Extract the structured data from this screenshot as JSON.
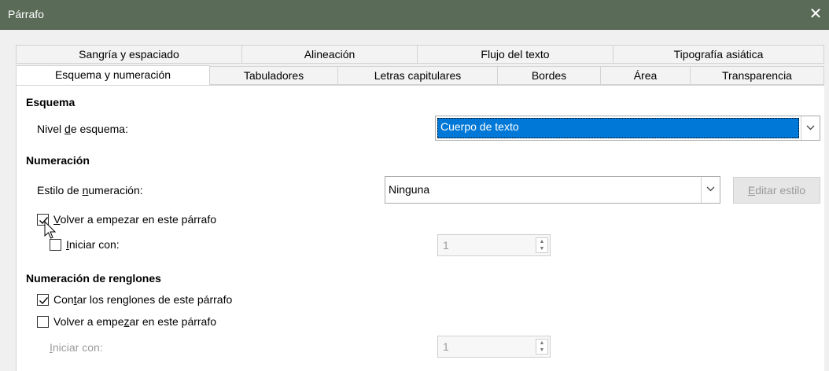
{
  "window": {
    "title": "Párrafo",
    "close_glyph": "✕"
  },
  "tabs_row1": [
    "Sangría y espaciado",
    "Alineación",
    "Flujo del texto",
    "Tipografía asiática"
  ],
  "tabs_row2": [
    "Esquema y numeración",
    "Tabuladores",
    "Letras capitulares",
    "Bordes",
    "Área",
    "Transparencia"
  ],
  "active_tab": "Esquema y numeración",
  "outline": {
    "heading": "Esquema",
    "level_label_pre": "Nivel ",
    "level_label_key": "d",
    "level_label_post": "e esquema:",
    "level_value": "Cuerpo de texto"
  },
  "numbering": {
    "heading": "Numeración",
    "style_label_pre": "Estilo de ",
    "style_label_key": "n",
    "style_label_post": "umeración:",
    "style_value": "Ninguna",
    "edit_key": "E",
    "edit_rest": "ditar estilo",
    "restart_checked": true,
    "restart_key": "V",
    "restart_rest": "olver a empezar en este párrafo",
    "start_checked": false,
    "start_key": "I",
    "start_rest": "niciar con:",
    "start_value": "1"
  },
  "line_numbering": {
    "heading": "Numeración de renglones",
    "count_checked": true,
    "count_pre": "Con",
    "count_key": "t",
    "count_post": "ar los renglones de este párrafo",
    "restart_checked": false,
    "restart_pre": "Volver a empe",
    "restart_key": "z",
    "restart_post": "ar en este párrafo",
    "start_key": "I",
    "start_rest": "niciar con:",
    "start_value": "1"
  },
  "icons": {
    "dropdown": "chevron-down-icon",
    "spin_up": "▲",
    "spin_down": "▼",
    "cursor": "mouse-pointer-icon"
  }
}
